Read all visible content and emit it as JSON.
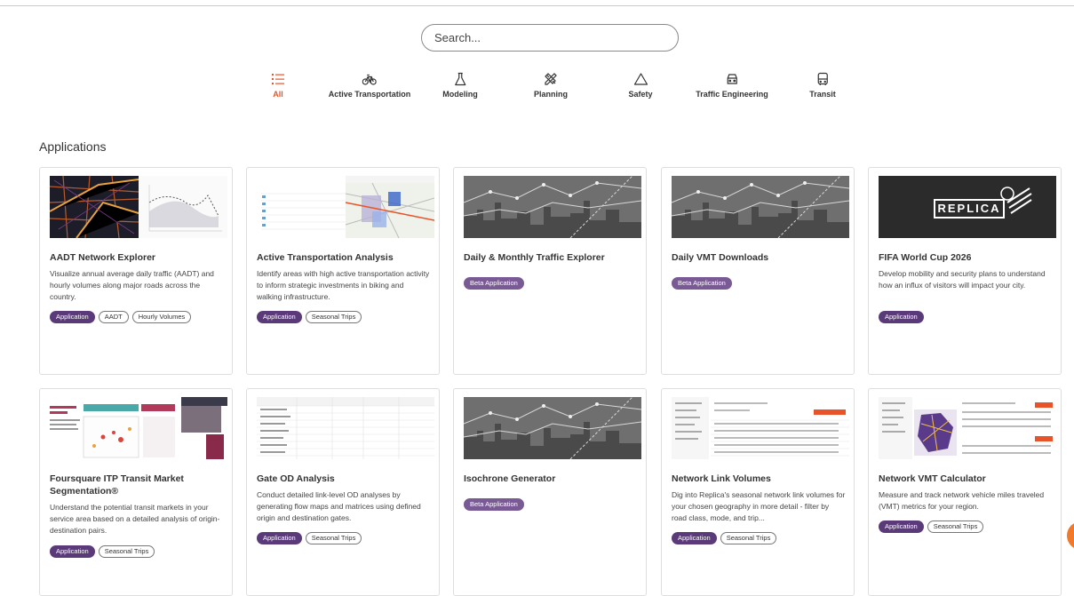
{
  "search": {
    "placeholder": "Search..."
  },
  "filters": [
    {
      "label": "All",
      "icon": "list-icon",
      "active": true
    },
    {
      "label": "Active Transportation",
      "icon": "bicycle-icon"
    },
    {
      "label": "Modeling",
      "icon": "flask-icon"
    },
    {
      "label": "Planning",
      "icon": "pencil-ruler-icon"
    },
    {
      "label": "Safety",
      "icon": "warning-triangle-icon"
    },
    {
      "label": "Traffic Engineering",
      "icon": "car-icon"
    },
    {
      "label": "Transit",
      "icon": "bus-icon"
    }
  ],
  "section_title": "Applications",
  "cards": [
    {
      "title": "AADT Network Explorer",
      "description": "Visualize annual average daily traffic (AADT) and hourly volumes along major roads across the country.",
      "tags": [
        "Application",
        "AADT",
        "Hourly Volumes"
      ],
      "thumbnail": "map-chart-screenshot"
    },
    {
      "title": "Active Transportation Analysis",
      "description": "Identify areas with high active transportation activity to inform strategic investments in biking and walking infrastructure.",
      "tags": [
        "Application",
        "Seasonal Trips"
      ],
      "thumbnail": "table-map-screenshot"
    },
    {
      "title": "Daily & Monthly Traffic Explorer",
      "description": "",
      "tags": [
        "Beta Application"
      ],
      "thumbnail": "city-skyline-graph"
    },
    {
      "title": "Daily VMT Downloads",
      "description": "",
      "tags": [
        "Beta Application"
      ],
      "thumbnail": "city-skyline-graph"
    },
    {
      "title": "FIFA World Cup 2026",
      "description": "Develop mobility and security plans to understand how an influx of visitors will impact your city.",
      "tags": [
        "Application"
      ],
      "thumbnail": "replica-logo",
      "logo_text": "REPLICA"
    },
    {
      "title": "Foursquare ITP Transit Market Segmentation®",
      "description": "Understand the potential transit markets in your service area based on a detailed analysis of origin-destination pairs.",
      "tags": [
        "Application",
        "Seasonal Trips"
      ],
      "thumbnail": "dashboard-screenshot"
    },
    {
      "title": "Gate OD Analysis",
      "description": "Conduct detailed link-level OD analyses by generating flow maps and matrices using defined origin and destination gates.",
      "tags": [
        "Application",
        "Seasonal Trips"
      ],
      "thumbnail": "matrix-table-screenshot"
    },
    {
      "title": "Isochrone Generator",
      "description": "",
      "tags": [
        "Beta Application"
      ],
      "thumbnail": "city-skyline-graph"
    },
    {
      "title": "Network Link Volumes",
      "description": "Dig into Replica's seasonal network link volumes for your chosen geography in more detail - filter by road class, mode, and trip...",
      "tags": [
        "Application",
        "Seasonal Trips"
      ],
      "thumbnail": "data-table-screenshot"
    },
    {
      "title": "Network VMT Calculator",
      "description": "Measure and track network vehicle miles traveled (VMT) metrics for your region.",
      "tags": [
        "Application",
        "Seasonal Trips"
      ],
      "thumbnail": "map-table-screenshot"
    }
  ],
  "colors": {
    "accent": "#e8532a",
    "tag_purple": "#5b3a7a",
    "beta_purple": "#7a5a94",
    "fab_orange": "#f07a2a"
  }
}
